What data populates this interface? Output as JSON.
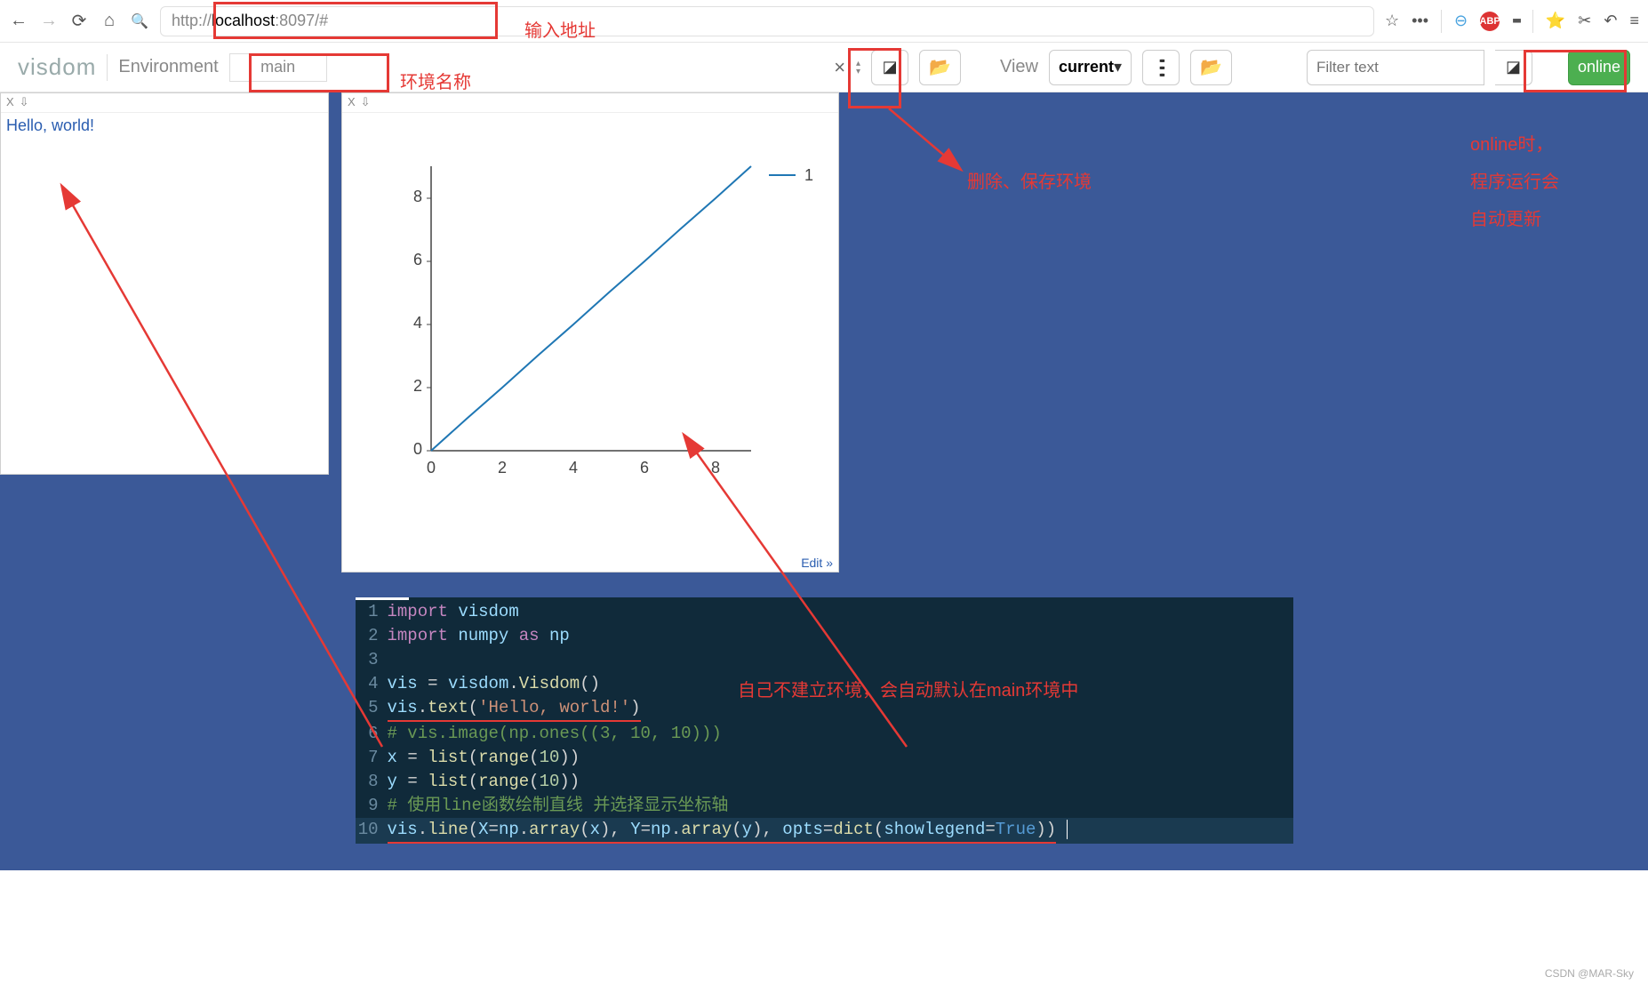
{
  "browser": {
    "url_prefix": "http://",
    "url_host": "localhost",
    "url_rest": ":8097/#"
  },
  "toolbar": {
    "brand": "visdom",
    "env_label": "Environment",
    "env_value": "main",
    "clear_x": "×",
    "view_label": "View",
    "view_value": "current ",
    "filter_placeholder": "Filter text",
    "online": "online"
  },
  "panels": {
    "text": {
      "close": "X",
      "pin": "⇩",
      "content": "Hello, world!"
    },
    "plot": {
      "close": "X",
      "pin": "⇩",
      "edit": "Edit »"
    }
  },
  "chart_data": {
    "type": "line",
    "series": [
      {
        "name": "1",
        "x": [
          0,
          1,
          2,
          3,
          4,
          5,
          6,
          7,
          8,
          9
        ],
        "y": [
          0,
          1,
          2,
          3,
          4,
          5,
          6,
          7,
          8,
          9
        ]
      }
    ],
    "x_ticks": [
      0,
      2,
      4,
      6,
      8
    ],
    "y_ticks": [
      0,
      2,
      4,
      6,
      8
    ],
    "xlim": [
      0,
      9
    ],
    "ylim": [
      0,
      9
    ],
    "legend": [
      "1"
    ]
  },
  "code": {
    "lines": [
      {
        "n": 1,
        "t": "import visdom"
      },
      {
        "n": 2,
        "t": "import numpy as np"
      },
      {
        "n": 3,
        "t": ""
      },
      {
        "n": 4,
        "t": "vis = visdom.Visdom()"
      },
      {
        "n": 5,
        "t": "vis.text('Hello, world!')"
      },
      {
        "n": 6,
        "t": "# vis.image(np.ones((3, 10, 10)))"
      },
      {
        "n": 7,
        "t": "x = list(range(10))"
      },
      {
        "n": 8,
        "t": "y = list(range(10))"
      },
      {
        "n": 9,
        "t": "# 使用line函数绘制直线 并选择显示坐标轴"
      },
      {
        "n": 10,
        "t": "vis.line(X=np.array(x), Y=np.array(y), opts=dict(showlegend=True))"
      }
    ]
  },
  "annotations": {
    "addr": "输入地址",
    "env": "环境名称",
    "folder": "删除、保存环境",
    "online1": "online时，",
    "online2": "程序运行会",
    "online3": "自动更新",
    "code_note": "自己不建立环境，会自动默认在main环境中"
  },
  "watermark": "CSDN @MAR-Sky"
}
